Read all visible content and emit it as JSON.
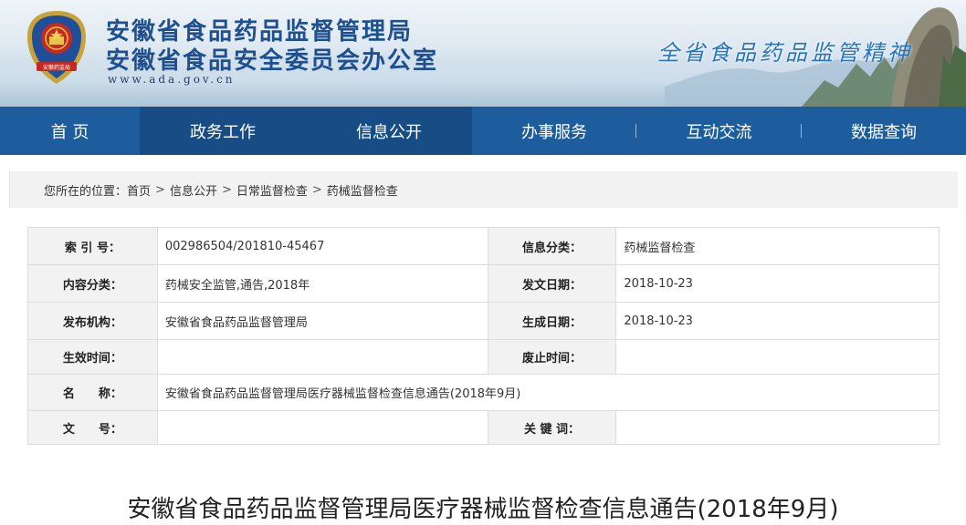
{
  "header": {
    "title_line1": "安徽省食品药品监督管理局",
    "title_line2": "安徽省食品安全委员会办公室",
    "url": "www.ada.gov.cn",
    "slogan": "全省食品药品监管精神",
    "emblem_text": "安徽药监局"
  },
  "nav": {
    "items": [
      {
        "label": "首 页"
      },
      {
        "label": "政务工作"
      },
      {
        "label": "信息公开"
      },
      {
        "label": "办事服务"
      },
      {
        "label": "互动交流"
      },
      {
        "label": "数据查询"
      }
    ]
  },
  "breadcrumb": {
    "prefix": "您所在的位置：",
    "items": [
      "首页",
      "信息公开",
      "日常监督检查",
      "药械监督检查"
    ],
    "separator": ">"
  },
  "info": {
    "index_no_label": "索 引 号：",
    "index_no": "002986504/201810-45467",
    "category_label": "信息分类：",
    "category": "药械监督检查",
    "content_label": "内容分类：",
    "content": "药械安全监管,通告,2018年",
    "issue_date_label": "发文日期：",
    "issue_date": "2018-10-23",
    "publisher_label": "发布机构：",
    "publisher": "安徽省食品药品监督管理局",
    "gen_date_label": "生成日期：",
    "gen_date": "2018-10-23",
    "effective_label": "生效时间：",
    "effective": "",
    "expire_label": "废止时间：",
    "expire": "",
    "name_label": "名　　称：",
    "name": "安徽省食品药品监督管理局医疗器械监督检查信息通告(2018年9月)",
    "doc_no_label": "文　　号：",
    "doc_no": "",
    "keywords_label": "关 键 词：",
    "keywords": ""
  },
  "article": {
    "title": "安徽省食品药品监督管理局医疗器械监督检查信息通告(2018年9月)"
  },
  "colors": {
    "nav_bg": "#1d5d9e",
    "nav_active": "#174c85",
    "title_blue": "#1e4f8f",
    "label_bg": "#f2f2f2"
  }
}
